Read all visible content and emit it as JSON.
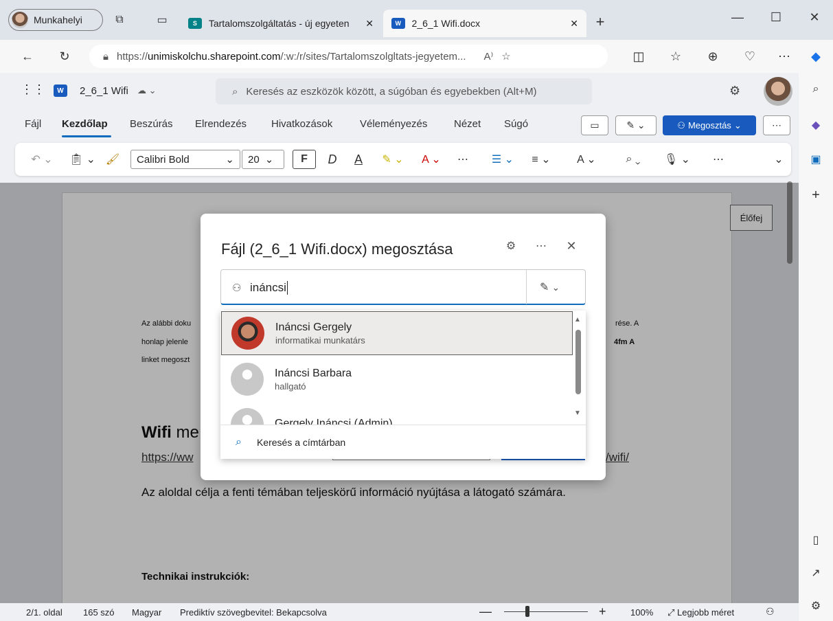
{
  "browser": {
    "profile_label": "Munkahelyi",
    "tabs": [
      {
        "title": "Tartalomszolgáltatás - új egyeten",
        "icon": "sharepoint-icon"
      },
      {
        "title": "2_6_1 Wifi.docx",
        "icon": "word-icon"
      }
    ],
    "url_prefix": "https://",
    "url_domain": "unimiskolchu.sharepoint.com",
    "url_rest": "/:w:/r/sites/Tartalomszolgltats-jegyetem..."
  },
  "word": {
    "doc_name": "2_6_1 Wifi",
    "search_placeholder": "Keresés az eszközök között, a súgóban és egyebekben (Alt+M)",
    "menu": [
      "Fájl",
      "Kezdőlap",
      "Beszúrás",
      "Elrendezés",
      "Hivatkozások",
      "Véleményezés",
      "Nézet",
      "Súgó"
    ],
    "share_label": "Megosztás",
    "font_name": "Calibri Bold",
    "font_size": "20",
    "bold_label": "F",
    "italic_label": "D",
    "underline_label": "A"
  },
  "document": {
    "para1_a": "Az alábbi doku",
    "para1_b": "rése. A",
    "para2_a": "honlap jelenle",
    "para2_b": "4fm A",
    "para3_a": "linket megoszt",
    "heading_a": "Wifi",
    "heading_b": "me",
    "link_a": "https://ww",
    "link_b": "/wifi/",
    "body": "Az aloldal célja a fenti témában teljeskörű információ nyújtása a látogató számára.",
    "tech": "Technikai instrukciók:",
    "header_tag": "Élőfej"
  },
  "status": {
    "page": "2/1. oldal",
    "words": "165 szó",
    "lang": "Magyar",
    "predict": "Prediktív szövegbevitel: Bekapcsolva",
    "zoom": "100%",
    "fit": "Legjobb méret",
    "zoom_level": 0.25
  },
  "dialog": {
    "title": "Fájl (2_6_1 Wifi.docx) megosztása",
    "input_value": "ináncsi",
    "people": [
      {
        "name": "Ináncsi Gergely",
        "role": "informatikai munkatárs"
      },
      {
        "name": "Ináncsi Barbara",
        "role": "hallgató"
      },
      {
        "name": "Gergely Ináncsi (Admin)",
        "role": ""
      }
    ],
    "search_directory": "Keresés a címtárban"
  },
  "colors": {
    "accent": "#185abd",
    "word_blue": "#0f6cbd"
  }
}
